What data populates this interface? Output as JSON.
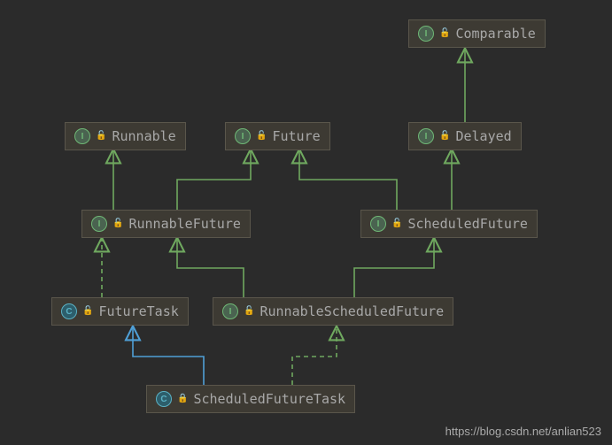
{
  "nodes": {
    "comparable": {
      "label": "Comparable",
      "kind": "I",
      "access": "open"
    },
    "runnable": {
      "label": "Runnable",
      "kind": "I",
      "access": "open"
    },
    "future": {
      "label": "Future",
      "kind": "I",
      "access": "open"
    },
    "delayed": {
      "label": "Delayed",
      "kind": "I",
      "access": "open"
    },
    "runnablefuture": {
      "label": "RunnableFuture",
      "kind": "I",
      "access": "open"
    },
    "scheduledfuture": {
      "label": "ScheduledFuture",
      "kind": "I",
      "access": "open"
    },
    "futuretask": {
      "label": "FutureTask",
      "kind": "C",
      "access": "open"
    },
    "rsf": {
      "label": "RunnableScheduledFuture",
      "kind": "I",
      "access": "open"
    },
    "sft": {
      "label": "ScheduledFutureTask",
      "kind": "C",
      "access": "closed"
    }
  },
  "watermark": "https://blog.csdn.net/anlian523",
  "chart_data": {
    "type": "diagram",
    "title": "",
    "nodes": [
      {
        "id": "Comparable",
        "stereotype": "interface"
      },
      {
        "id": "Runnable",
        "stereotype": "interface"
      },
      {
        "id": "Future",
        "stereotype": "interface"
      },
      {
        "id": "Delayed",
        "stereotype": "interface"
      },
      {
        "id": "RunnableFuture",
        "stereotype": "interface"
      },
      {
        "id": "ScheduledFuture",
        "stereotype": "interface"
      },
      {
        "id": "FutureTask",
        "stereotype": "class"
      },
      {
        "id": "RunnableScheduledFuture",
        "stereotype": "interface"
      },
      {
        "id": "ScheduledFutureTask",
        "stereotype": "class"
      }
    ],
    "edges": [
      {
        "from": "Delayed",
        "to": "Comparable",
        "kind": "extends"
      },
      {
        "from": "RunnableFuture",
        "to": "Runnable",
        "kind": "extends"
      },
      {
        "from": "RunnableFuture",
        "to": "Future",
        "kind": "extends"
      },
      {
        "from": "ScheduledFuture",
        "to": "Future",
        "kind": "extends"
      },
      {
        "from": "ScheduledFuture",
        "to": "Delayed",
        "kind": "extends"
      },
      {
        "from": "FutureTask",
        "to": "RunnableFuture",
        "kind": "implements"
      },
      {
        "from": "RunnableScheduledFuture",
        "to": "RunnableFuture",
        "kind": "extends"
      },
      {
        "from": "RunnableScheduledFuture",
        "to": "ScheduledFuture",
        "kind": "extends"
      },
      {
        "from": "ScheduledFutureTask",
        "to": "FutureTask",
        "kind": "extends-class"
      },
      {
        "from": "ScheduledFutureTask",
        "to": "RunnableScheduledFuture",
        "kind": "implements"
      }
    ]
  }
}
